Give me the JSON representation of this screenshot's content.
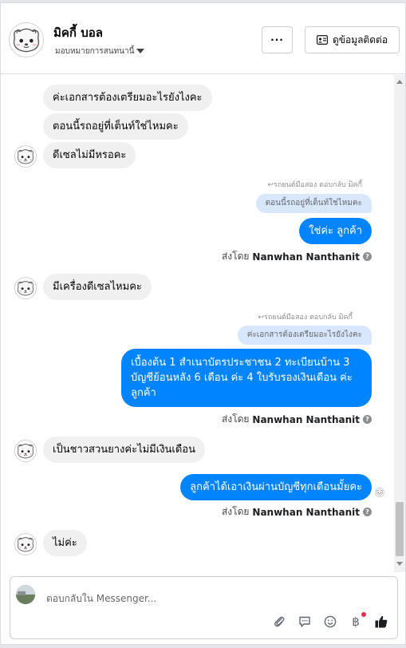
{
  "header": {
    "page_name": "มิคกี้ บอล",
    "assign_label": "มอบหมายการสนทนานี้",
    "more_label": "···",
    "contact_label": "ดูข้อมูลติดต่อ"
  },
  "messages": {
    "m1": "ค่ะเอกสารต้องเตรียมอะไรยังไงคะ",
    "m2": "ตอนนี้รถอยู่ที่เต็นท์ใช่ไหมคะ",
    "m3": "ดีเซลไม่มีหรอคะ",
    "reply1_note": "รถยนต์มือสอง ตอบกลับ มิคกี้",
    "reply1_quote": "ตอนนี้รถอยู่ที่เต็นท์ใช่ไหมคะ",
    "m4": "ใช่ค่ะ ลูกค้า",
    "sent1_prefix": "ส่งโดย",
    "sent1_name": "Nanwhan Nanthanit",
    "m5": "มีเครื่องดีเซลไหมคะ",
    "reply2_note": "รถยนต์มือสอง ตอบกลับ มิคกี้",
    "reply2_quote": "ค่ะเอกสารต้องเตรียมอะไรยังไงคะ",
    "m6_line1": "เบื้องต้น 1 สำเนาบัตรประชาชน 2 ทะเบียนบ้าน 3",
    "m6_line2": "บัญชีย้อนหลัง 6 เดือน ค่ะ 4 ใบรับรองเงินเดือน ค่ะ",
    "m6_line3": "ลูกค้า",
    "sent2_prefix": "ส่งโดย",
    "sent2_name": "Nanwhan Nanthanit",
    "m7": "เป็นชาวสวนยางค่ะไม่มีเงินเดือน",
    "m8": "ลูกค้าได้เอาเงินผ่านบัญชีทุกเดือนมั้ยคะ",
    "sent3_prefix": "ส่งโดย",
    "sent3_name": "Nanwhan Nanthanit",
    "m9": "ไม่ค่ะ"
  },
  "composer": {
    "placeholder": "ตอบกลับใน Messenger..."
  },
  "icons": {
    "attach": "paperclip-icon",
    "saved_replies": "chat-bubble-icon",
    "emoji": "smiley-icon",
    "payment": "baht-icon",
    "like": "thumbs-up-icon"
  },
  "colors": {
    "outgoing_bubble": "#0084ff",
    "incoming_bubble": "#f0f0f0",
    "quote_bubble": "#d8e7fb",
    "notification_dot": "#f02849"
  }
}
